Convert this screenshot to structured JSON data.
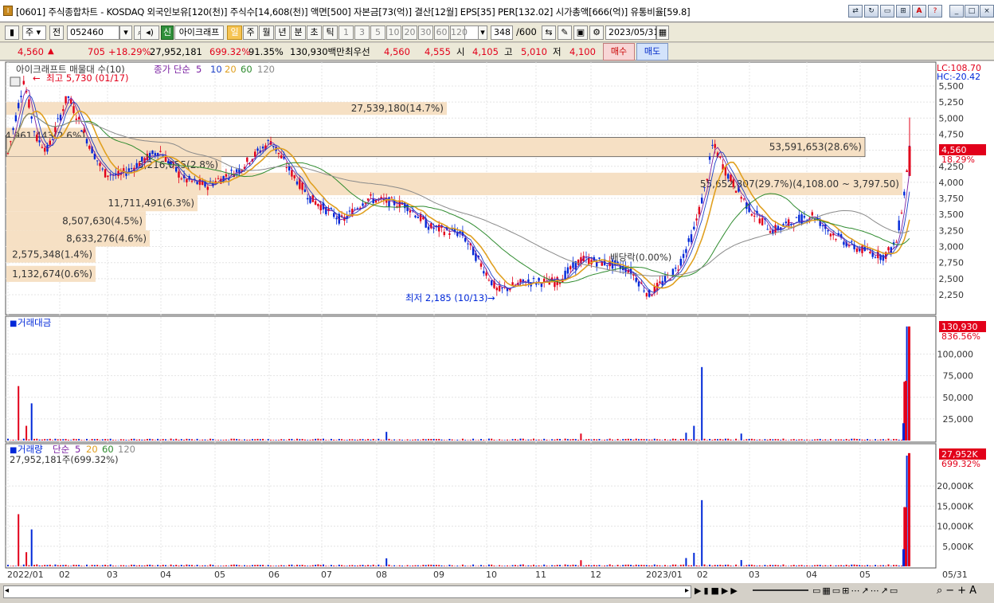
{
  "window": {
    "title": "[0601] 주식종합차트 - KOSDAQ 외국인보유[120(천)] 주식수[14,608(천)] 액면[500] 자본금[73(억)] 결산[12월] EPS[35] PER[132.02] 시가총액[666(억)] 유통비율[59.8]",
    "icon": "app-icon"
  },
  "toolbar": {
    "period_select": "주",
    "prev": "전",
    "code": "052460",
    "stock_name": "아이크래프",
    "stock_badge": "신",
    "units": [
      "일",
      "주",
      "월",
      "년",
      "분",
      "초",
      "틱"
    ],
    "active_unit": "일",
    "intervals": [
      "1",
      "3",
      "5",
      "10",
      "20",
      "30",
      "60",
      "120"
    ],
    "count": "348",
    "count_total": "/600",
    "date": "2023/05/31"
  },
  "quote": {
    "price": "4,560",
    "arrow": "▲",
    "change": "705",
    "change_pct": "+18.29%",
    "volume": "27,952,181",
    "vol_ratio": "699.32%",
    "strength": "91.35%",
    "amount": "130,930백만",
    "best_label": "최우선",
    "ask": "4,560",
    "bid": "4,555",
    "open_label": "시",
    "open": "4,105",
    "high_label": "고",
    "high": "5,010",
    "low_label": "저",
    "low": "4,100",
    "buy": "매수",
    "sell": "매도"
  },
  "price_panel": {
    "legend_title": "아이크래프트 매물대 수(10)",
    "legend_ma": "종가 단순",
    "ma_periods": [
      "5",
      "10",
      "20",
      "60",
      "120"
    ],
    "lc": "LC:108.70",
    "hc": "HC:-20.42",
    "high_note": "최고 5,730 (01/17)",
    "low_note": "최저 2,185 (10/13)",
    "dividend_note": "배당락(0.00%)",
    "current_price": "4,560",
    "current_pct": "18.29%",
    "y_ticks": [
      "5,500",
      "5,250",
      "5,000",
      "4,750",
      "4,500",
      "4,250",
      "4,000",
      "3,750",
      "3,500",
      "3,250",
      "3,000",
      "2,750",
      "2,500",
      "2,250"
    ],
    "volume_profile": [
      {
        "label": "27,539,180(14.7%)"
      },
      {
        "label": "4,961,443(2.6%)"
      },
      {
        "label": "53,591,653(28.6%)"
      },
      {
        "label": "5,216,055(2.8%)"
      },
      {
        "label": "55,652,807(29.7%)(4,108.00 ~ 3,797.50)"
      },
      {
        "label": "11,711,491(6.3%)"
      },
      {
        "label": "8,507,630(4.5%)"
      },
      {
        "label": "8,633,276(4.6%)"
      },
      {
        "label": "2,575,348(1.4%)"
      },
      {
        "label": "1,132,674(0.6%)"
      }
    ]
  },
  "amount_panel": {
    "title": "거래대금",
    "current": "130,930",
    "pct": "836.56%",
    "y_ticks": [
      "100,000",
      "75,000",
      "50,000",
      "25,000"
    ]
  },
  "volume_panel": {
    "title": "거래량",
    "ma_label": "단순",
    "ma_periods": [
      "5",
      "20",
      "60",
      "120"
    ],
    "value_line": "27,952,181주(699.32%)",
    "current": "27,952K",
    "pct": "699.32%",
    "y_ticks": [
      "20,000K",
      "15,000K",
      "10,000K",
      "5,000K"
    ]
  },
  "x_axis": [
    "2022/01",
    "02",
    "03",
    "04",
    "05",
    "06",
    "07",
    "08",
    "09",
    "10",
    "11",
    "12",
    "2023/01",
    "02",
    "03",
    "04",
    "05"
  ],
  "x_end": "05/31",
  "colors": {
    "up": "#e2001a",
    "down": "#0028d8",
    "ma5": "#7a1fa2",
    "ma10": "#1b3fc7",
    "ma20": "#e0a020",
    "ma60": "#2e8b2e",
    "ma120": "#8a8a8a",
    "profile": "#f6e0c4"
  }
}
